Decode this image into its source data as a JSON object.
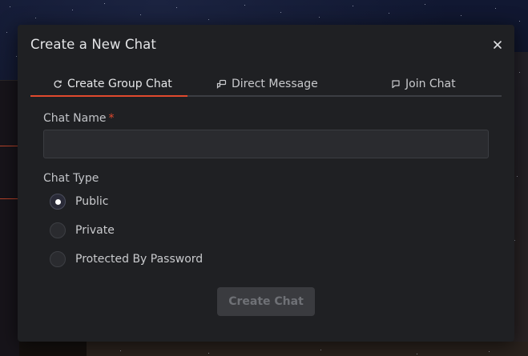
{
  "modal": {
    "title": "Create a New Chat",
    "close_icon": "close-icon"
  },
  "tabs": [
    {
      "label": "Create Group Chat",
      "icon": "refresh-chat-icon",
      "active": true
    },
    {
      "label": "Direct Message",
      "icon": "chat-bubbles-icon",
      "active": false
    },
    {
      "label": "Join Chat",
      "icon": "chat-bubble-icon",
      "active": false
    }
  ],
  "form": {
    "chat_name": {
      "label": "Chat Name",
      "required_marker": "*",
      "value": "",
      "placeholder": ""
    },
    "chat_type": {
      "label": "Chat Type",
      "options": [
        {
          "label": "Public",
          "selected": true
        },
        {
          "label": "Private",
          "selected": false
        },
        {
          "label": "Protected By Password",
          "selected": false
        }
      ]
    },
    "submit_label": "Create Chat",
    "submit_disabled": true
  },
  "colors": {
    "accent": "#e0492e",
    "modal_bg": "#1f2023",
    "input_bg": "#2a2b2f"
  }
}
